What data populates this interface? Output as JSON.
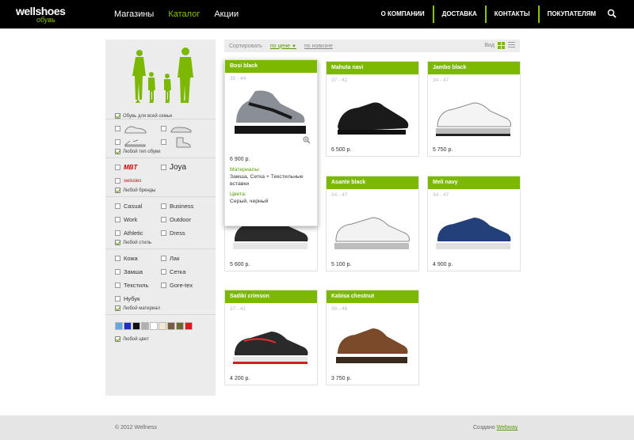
{
  "header": {
    "logo_main": "wellshoes",
    "logo_sub": "обувь",
    "nav": [
      {
        "label": "Магазины"
      },
      {
        "label": "Каталог",
        "active": true
      },
      {
        "label": "Акции"
      }
    ],
    "right_nav": [
      {
        "label": "О КОМПАНИИ"
      },
      {
        "label": "ДОСТАВКА"
      },
      {
        "label": "КОНТАКТЫ"
      },
      {
        "label": "ПОКУПАТЕЛЯМ"
      }
    ],
    "search_icon": "search-icon"
  },
  "sidebar": {
    "family": {
      "label": "Обувь для всей семьи"
    },
    "type": {
      "any_label": "Любой тип обуви"
    },
    "brands": {
      "items": [
        "MBT",
        "Joya",
        "swissies"
      ],
      "any_label": "Любой бренды"
    },
    "style": {
      "items": [
        "Casual",
        "Business",
        "Work",
        "Outdoor",
        "Athletic",
        "Dress"
      ],
      "any_label": "Любой стиль"
    },
    "material": {
      "items": [
        "Кожа",
        "Лак",
        "Замша",
        "Сетка",
        "Текстиль",
        "Gore-tex",
        "Нубук"
      ],
      "any_label": "Любой материал"
    },
    "color": {
      "swatches": [
        "#5fa8e0",
        "#1f2ec8",
        "#111111",
        "#b0b0b0",
        "#ffffff",
        "#efe6d4",
        "#7a5c3e",
        "#6b6b2e",
        "#e01a1a"
      ],
      "any_label": "Любой цвет"
    }
  },
  "toolbar": {
    "sort_label": "Сортировать",
    "sort_price": "по цене",
    "sort_new": "по новизне",
    "view_label": "Вид"
  },
  "products": [
    {
      "name": "Bosi black",
      "size": "35 - 44",
      "price": "6 900 р.",
      "materials_label": "Материалы:",
      "materials": "Замша, Сетка + Текстильные вставки",
      "colors_label": "Цвета:",
      "colors": "Серый, черный"
    },
    {
      "name": "Mahuta navi",
      "size": "37 - 42",
      "price": "6 500 р."
    },
    {
      "name": "Jambo black",
      "size": "34 - 47",
      "price": "5 750 р."
    },
    {
      "name": "Asante black",
      "size": "34 - 47",
      "price": "5 100 р."
    },
    {
      "name": "Meli navy",
      "size": "34 - 47",
      "price": "4 900 р."
    },
    {
      "name": "",
      "size": "",
      "price": "5 600 р."
    },
    {
      "name": "Sadiki crimson",
      "size": "37 - 41",
      "price": "4 200 р."
    },
    {
      "name": "Kabisa chestnut",
      "size": "38 - 46",
      "price": "3 750 р."
    }
  ],
  "footer": {
    "copyright": "© 2012 Wellness",
    "made_by": "Создано",
    "made_link": "Webway"
  }
}
